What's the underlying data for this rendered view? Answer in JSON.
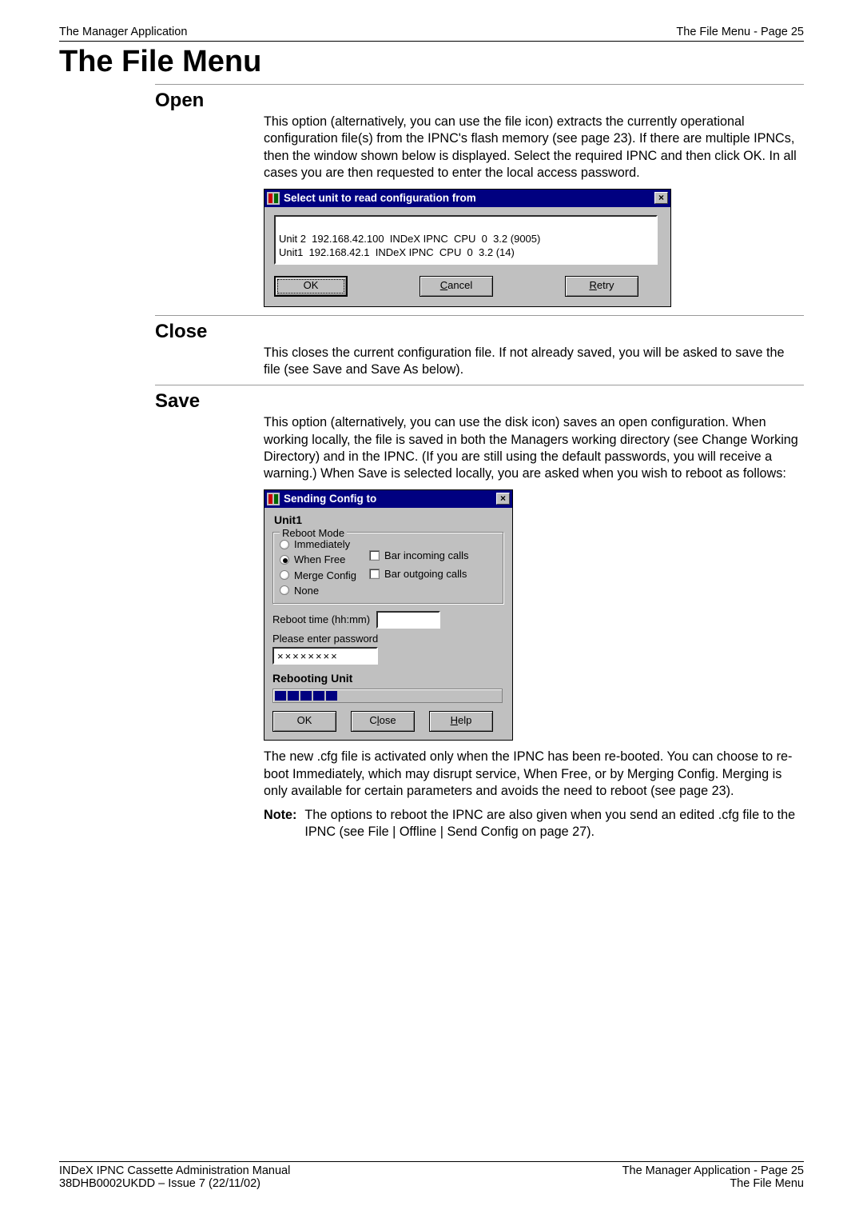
{
  "header": {
    "left": "The Manager Application",
    "right": "The File Menu - Page 25"
  },
  "title": "The File Menu",
  "sections": {
    "open": {
      "heading": "Open",
      "para": "This option (alternatively, you can use the file icon) extracts the currently operational configuration file(s) from the IPNC's flash memory (see page 23). If there are multiple IPNCs, then the window shown below is displayed. Select the required IPNC and then click OK. In all cases you are then requested to enter the local access password."
    },
    "close": {
      "heading": "Close",
      "para": "This closes the current configuration file. If not already saved, you will be asked to save the file (see Save and Save As below)."
    },
    "save": {
      "heading": "Save",
      "para1": "This option (alternatively, you can use the disk icon) saves an open configuration. When working locally, the file is saved in both the Managers working directory (see Change Working Directory) and in the IPNC. (If you are still using the default passwords, you will receive a warning.) When Save is selected locally, you are asked when you wish to reboot as follows:",
      "para2": "The new .cfg file is activated only when the IPNC has been re-booted. You can choose to re-boot Immediately, which may disrupt service, When Free, or by Merging Config. Merging is only available for certain parameters and avoids the need to reboot (see page 23).",
      "note_label": "Note:",
      "note_text": "The options to reboot the IPNC are also given when you send an edited .cfg file to the IPNC (see File | Offline | Send Config on page 27)."
    }
  },
  "dialog_select": {
    "title": "Select unit to read configuration from",
    "rows": [
      "Unit 2  192.168.42.100  INDeX IPNC  CPU  0  3.2 (9005)",
      "Unit1  192.168.42.1  INDeX IPNC  CPU  0  3.2 (14)"
    ],
    "buttons": {
      "ok": "OK",
      "cancel": "Cancel",
      "cancel_mn": "C",
      "retry": "Retry",
      "retry_mn": "R"
    }
  },
  "dialog_send": {
    "title": "Sending Config to",
    "unit": "Unit1",
    "group_legend": "Reboot Mode",
    "radios": {
      "immediately": "Immediately",
      "when_free": "When Free",
      "merge": "Merge Config",
      "none": "None"
    },
    "radio_selected": "when_free",
    "checks": {
      "bar_in": "Bar incoming calls",
      "bar_out": "Bar outgoing calls"
    },
    "reboot_time_label": "Reboot time (hh:mm)",
    "reboot_time_value": "",
    "password_label": "Please enter password",
    "password_value": "××××××××",
    "rebooting_label": "Rebooting Unit",
    "progress_segments": 5,
    "buttons": {
      "ok": "OK",
      "close": "Close",
      "close_mn": "l",
      "help": "Help",
      "help_mn": "H"
    }
  },
  "footer": {
    "left1": "INDeX IPNC Cassette Administration Manual",
    "left2": "38DHB0002UKDD – Issue 7 (22/11/02)",
    "right1": "The Manager Application - Page 25",
    "right2": "The File Menu"
  }
}
